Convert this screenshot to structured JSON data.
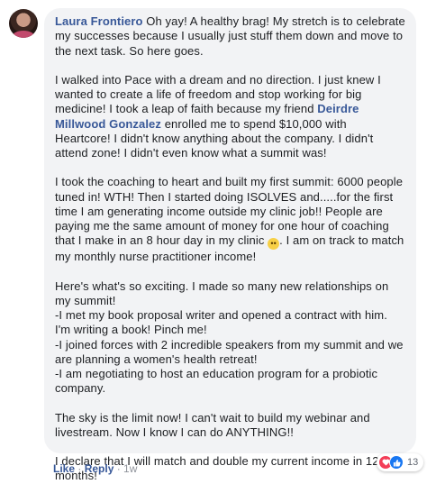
{
  "comment": {
    "author": "Laura Frontiero",
    "p1": " Oh yay! A healthy brag! My stretch is to celebrate my successes because I usually just stuff them down and move to the next task. So here goes.",
    "p2_before": "I walked into Pace with a dream and no direction. I just knew I wanted to create a life of freedom and stop working for big medicine! I took a leap of faith because my friend ",
    "p2_mention": "Deirdre Millwood Gonzalez",
    "p2_after": " enrolled me to spend $10,000 with Heartcore! I didn't know anything about the company. I didn't attend zone! I didn't even know what a summit was!",
    "p3_before": "I took the coaching to heart and built my first summit: 6000 people tuned in! WTH! Then I started doing ISOLVES and.....for the first time I am generating income outside my clinic job!! People are paying me the same amount of money for one hour of coaching that I make in an 8 hour day in my clinic ",
    "p3_emoji": "😳",
    "p3_after": ". I am on track to match my monthly nurse practitioner income!",
    "p4": "Here's what's so exciting. I made so many new relationships on my summit!\n-I met my book proposal writer and opened a contract with him. I'm writing a book! Pinch me!\n-I joined forces with 2 incredible speakers from my summit and we are planning a women's health retreat!\n-I am negotiating to host an education program for a probiotic company.",
    "p5": "The sky is the limit now! I can't wait to build my webinar and livestream. Now I know I can do ANYTHING!!",
    "p6": "I declare that I will match and double my current income in 12 months!"
  },
  "reactions": {
    "icons": [
      "love-icon",
      "like-icon"
    ],
    "count": "13",
    "love_color": "#f33e58",
    "like_color": "#1877f2"
  },
  "actions": {
    "like": "Like",
    "sep1": " · ",
    "reply": "Reply",
    "sep2": " · ",
    "time": "1w"
  }
}
